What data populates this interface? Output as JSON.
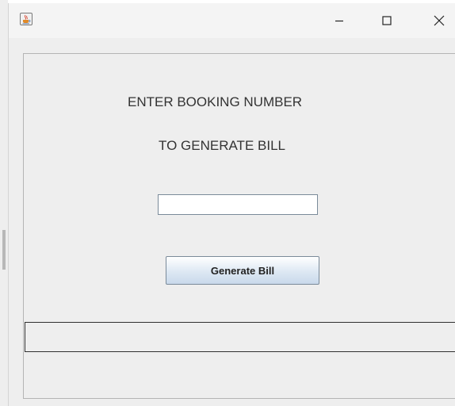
{
  "window": {
    "title": "",
    "app_icon": "java-cup-icon",
    "controls": {
      "minimize": "minimize-icon",
      "maximize": "maximize-icon",
      "close": "close-icon"
    }
  },
  "form": {
    "heading_line1": "ENTER BOOKING NUMBER",
    "heading_line2": "TO GENERATE BILL",
    "booking_number_value": "",
    "generate_button_label": "Generate Bill",
    "result_text": ""
  }
}
